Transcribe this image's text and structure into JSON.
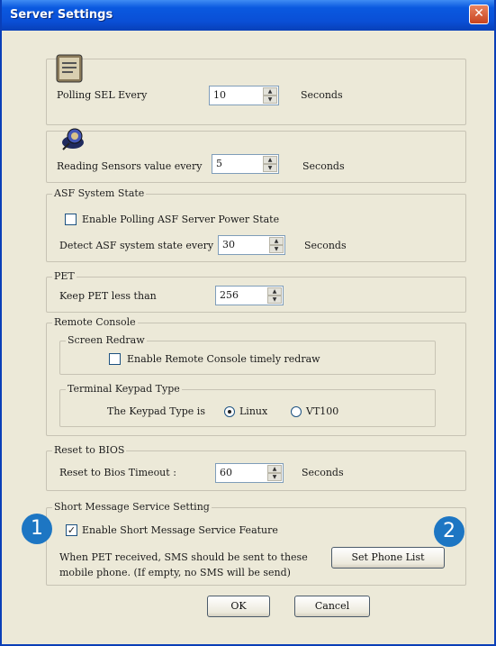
{
  "window": {
    "title": "Server Settings",
    "close_glyph": "✕"
  },
  "polling_sel": {
    "label": "Polling SEL Every",
    "value": "10",
    "unit": "Seconds",
    "icon": "sel-log-icon"
  },
  "sensors": {
    "label": "Reading Sensors value every",
    "value": "5",
    "unit": "Seconds",
    "icon": "sensor-probe-icon"
  },
  "asf": {
    "group_label": "ASF System State",
    "enable_label": "Enable Polling ASF Server Power State",
    "enable_checked": false,
    "detect_label": "Detect ASF system state every",
    "value": "30",
    "unit": "Seconds"
  },
  "pet": {
    "group_label": "PET",
    "label": "Keep PET less than",
    "value": "256"
  },
  "remote_console": {
    "group_label": "Remote Console",
    "screen_redraw": {
      "group_label": "Screen Redraw",
      "enable_label": "Enable Remote Console timely redraw",
      "checked": false
    },
    "keypad": {
      "group_label": "Terminal Keypad Type",
      "label": "The Keypad Type is",
      "options": [
        "Linux",
        "VT100"
      ],
      "selected": "Linux"
    }
  },
  "reset_bios": {
    "group_label": "Reset to BIOS",
    "label": "Reset to Bios Timeout :",
    "value": "60",
    "unit": "Seconds"
  },
  "sms": {
    "group_label": "Short Message Service Setting",
    "enable_label": "Enable Short Message Service Feature",
    "enable_checked": true,
    "note_line1": "When PET received, SMS should be sent to these",
    "note_line2": "mobile phone. (If empty, no SMS will be send)",
    "set_phone_label": "Set Phone List"
  },
  "footer": {
    "ok_label": "OK",
    "cancel_label": "Cancel"
  },
  "callouts": [
    "1",
    "2"
  ],
  "colors": {
    "titlebar": "#0a4fd6",
    "dialog_bg": "#ece9d8",
    "callout": "#1d76c3",
    "close": "#c8431f"
  }
}
